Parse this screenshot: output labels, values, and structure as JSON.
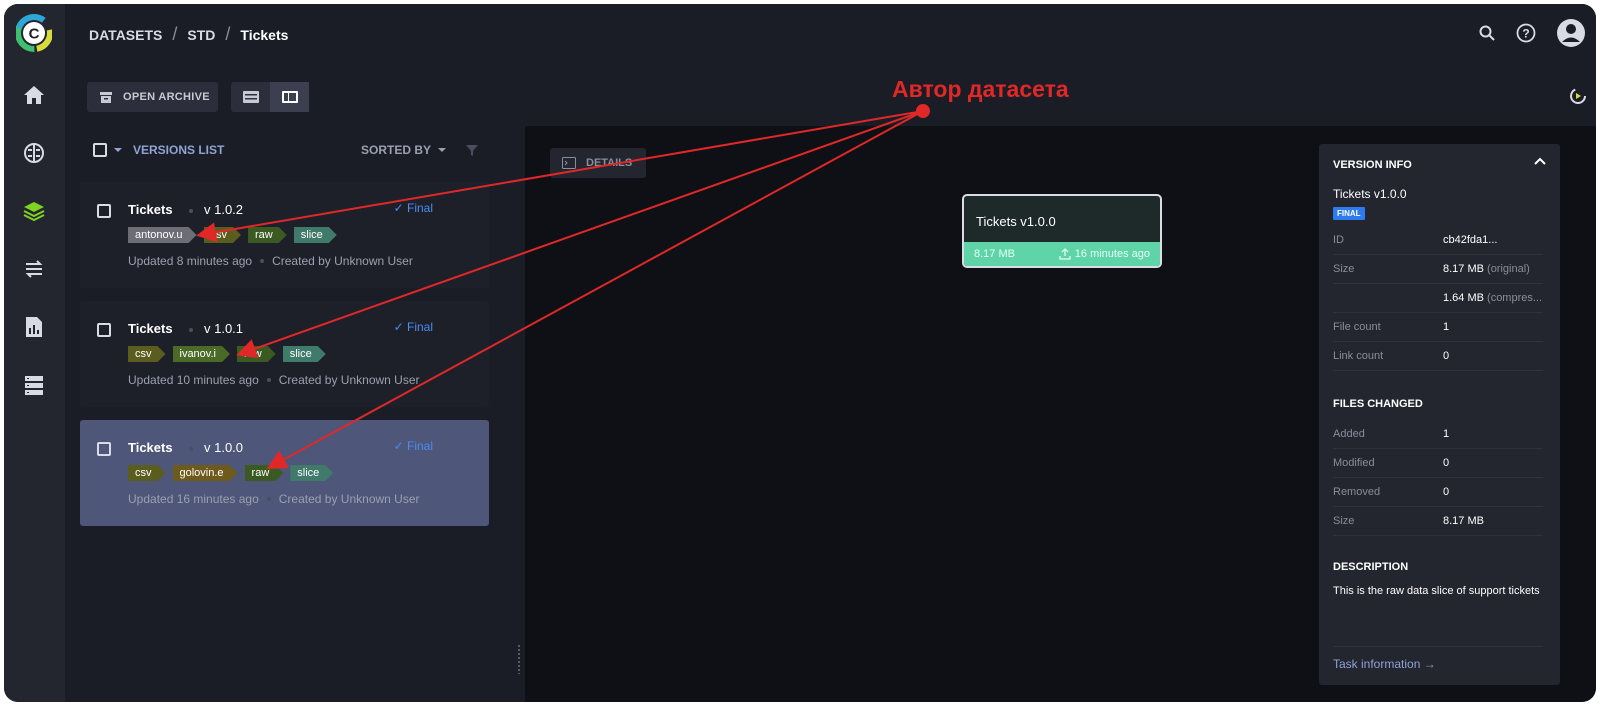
{
  "breadcrumb": {
    "root": "DATASETS",
    "project": "STD",
    "current": "Tickets"
  },
  "toolbar": {
    "archive_label": "OPEN ARCHIVE"
  },
  "versions_list": {
    "title": "VERSIONS LIST",
    "sorted_label": "SORTED BY",
    "versions": [
      {
        "name": "Tickets",
        "version": "v 1.0.2",
        "status": "✓ Final",
        "tags": [
          "antonov.u",
          "csv",
          "raw",
          "slice"
        ],
        "updated": "Updated 8 minutes ago",
        "created": "Created by Unknown User"
      },
      {
        "name": "Tickets",
        "version": "v 1.0.1",
        "status": "✓ Final",
        "tags": [
          "csv",
          "ivanov.i",
          "raw",
          "slice"
        ],
        "updated": "Updated 10 minutes ago",
        "created": "Created by Unknown User"
      },
      {
        "name": "Tickets",
        "version": "v 1.0.0",
        "status": "✓ Final",
        "tags": [
          "csv",
          "golovin.e",
          "raw",
          "slice"
        ],
        "updated": "Updated 16 minutes ago",
        "created": "Created by Unknown User"
      }
    ]
  },
  "canvas": {
    "details_label": "DETAILS",
    "node": {
      "title": "Tickets v1.0.0",
      "size": "8.17 MB",
      "time": "16 minutes ago"
    }
  },
  "version_info": {
    "title": "VERSION INFO",
    "name": "Tickets v1.0.0",
    "badge": "FINAL",
    "rows": [
      {
        "key": "ID",
        "value": "cb42fda1...",
        "note": ""
      },
      {
        "key": "Size",
        "value": "8.17 MB",
        "note": "(original)"
      },
      {
        "key": "",
        "value": "1.64 MB",
        "note": "(compres..."
      },
      {
        "key": "File count",
        "value": "1",
        "note": ""
      },
      {
        "key": "Link count",
        "value": "0",
        "note": ""
      }
    ],
    "files_changed_title": "FILES CHANGED",
    "files_changed": [
      {
        "key": "Added",
        "value": "1"
      },
      {
        "key": "Modified",
        "value": "0"
      },
      {
        "key": "Removed",
        "value": "0"
      },
      {
        "key": "Size",
        "value": "8.17 MB"
      }
    ],
    "description_title": "DESCRIPTION",
    "description": "This is the raw data slice of support tickets",
    "task_link": "Task information →"
  },
  "annotation": {
    "label": "Автор датасета",
    "color": "#e02828"
  },
  "colors": {
    "accent": "#4a8cf0",
    "node_bar": "#5fd4a8",
    "selected_card": "#4e5679"
  }
}
